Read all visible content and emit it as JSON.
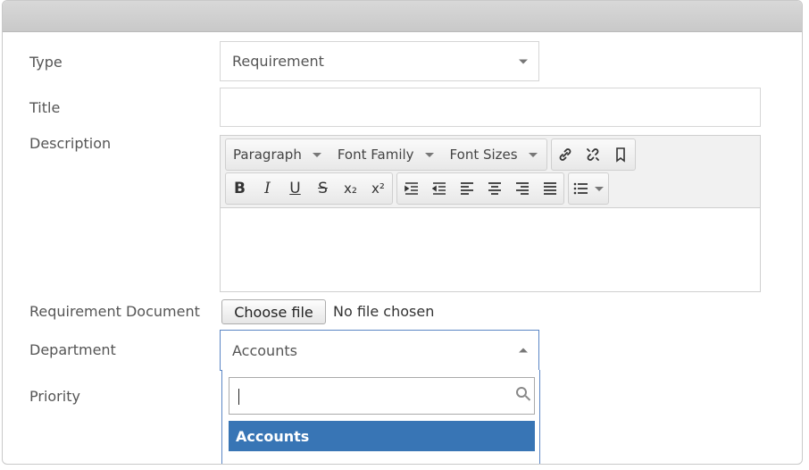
{
  "form": {
    "type": {
      "label": "Type",
      "value": "Requirement"
    },
    "title": {
      "label": "Title",
      "value": ""
    },
    "description": {
      "label": "Description",
      "toolbar": {
        "paragraph": "Paragraph",
        "font_family": "Font Family",
        "font_sizes": "Font Sizes",
        "bold": "B",
        "italic": "I",
        "underline": "U",
        "strike": "S",
        "subscript": "x₂",
        "superscript": "x²"
      }
    },
    "requirement_document": {
      "label": "Requirement Document",
      "button": "Choose file",
      "status": "No file chosen"
    },
    "department": {
      "label": "Department",
      "value": "Accounts",
      "options": [
        "Accounts"
      ],
      "selected_option": "Accounts"
    },
    "priority": {
      "label": "Priority"
    }
  },
  "colors": {
    "selected_option_bg": "#3875b5",
    "focus_border": "#5b86c5"
  }
}
